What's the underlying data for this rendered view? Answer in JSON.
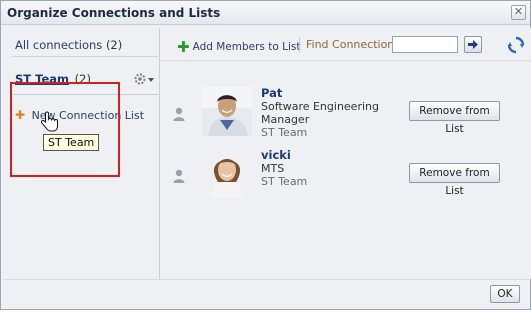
{
  "dialog": {
    "title": "Organize Connections and Lists",
    "close_label": "✕"
  },
  "left": {
    "all_connections_label": "All connections",
    "all_connections_count": "(2)",
    "list_name": "ST Team",
    "list_count": "(2)",
    "new_list_label": "New Connection List",
    "tooltip": "ST Team"
  },
  "toolbar": {
    "add_members_label": "Add Members to List",
    "find_label": "Find Connection",
    "find_value": ""
  },
  "people": [
    {
      "name": "Pat",
      "title_line1": "Software Engineering",
      "title_line2": "Manager",
      "list": "ST Team",
      "button": "Remove from List"
    },
    {
      "name": "vicki",
      "title_line1": "MTS",
      "title_line2": "",
      "list": "ST Team",
      "button": "Remove from List"
    }
  ],
  "footer": {
    "ok_label": "OK"
  },
  "colors": {
    "highlight_box": "#d02020",
    "link": "#1c3a78"
  }
}
